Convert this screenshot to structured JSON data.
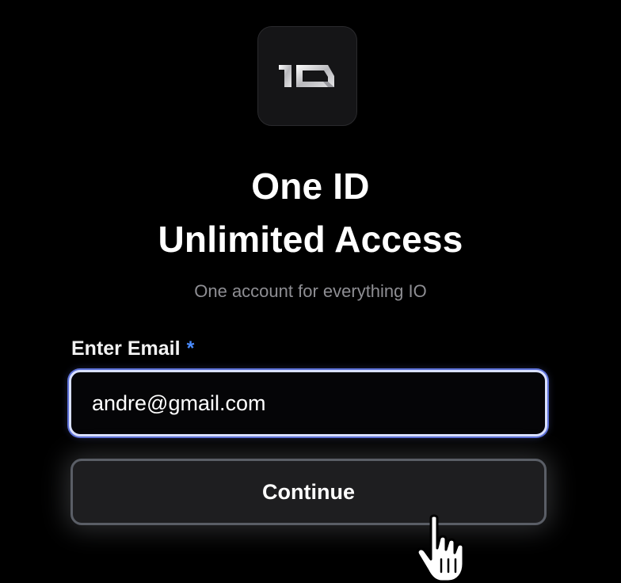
{
  "logo": {
    "icon": "io-logo-icon",
    "text": "IO"
  },
  "headline": {
    "line1": "One ID",
    "line2": "Unlimited Access"
  },
  "subtitle": "One account for everything IO",
  "email_field": {
    "label": "Enter Email",
    "required_marker": "*",
    "value": "andre@gmail.com"
  },
  "continue_button": {
    "label": "Continue"
  },
  "cursor": {
    "icon": "hand-pointer-icon"
  },
  "colors": {
    "background": "#000000",
    "accent": "#4a8cff",
    "input_focus_border": "#d9e0ff",
    "button_background": "#1e1e20",
    "subtitle": "#8e8e93"
  }
}
